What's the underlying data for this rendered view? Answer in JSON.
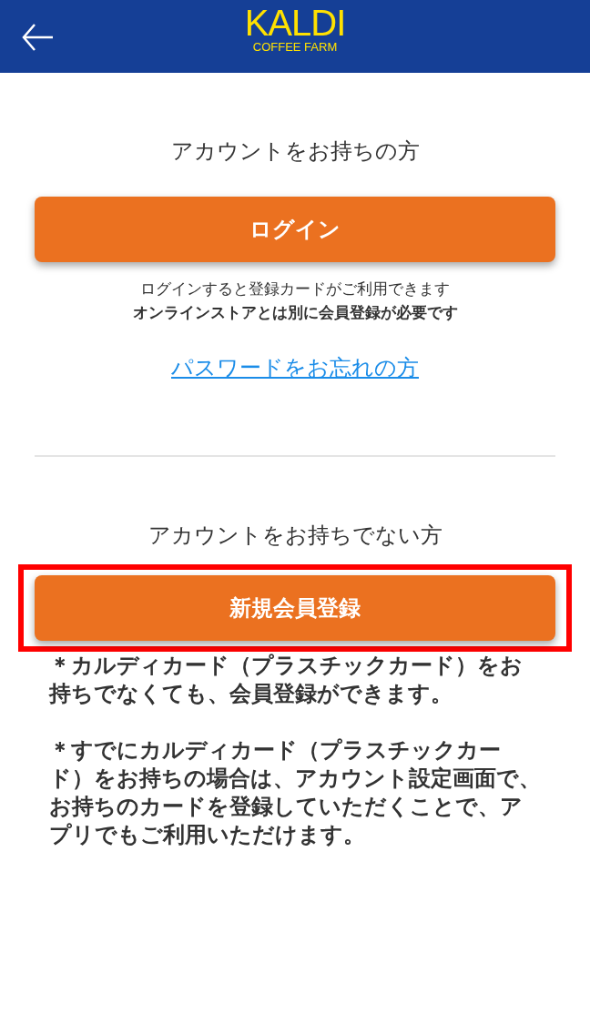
{
  "header": {
    "logo_main": "KALDI",
    "logo_sub": "COFFEE FARM"
  },
  "login_section": {
    "heading": "アカウントをお持ちの方",
    "button": "ログイン",
    "note": "ログインすると登録カードがご利用できます",
    "note_bold": "オンラインストアとは別に会員登録が必要です",
    "link": "パスワードをお忘れの方"
  },
  "register_section": {
    "heading": "アカウントをお持ちでない方",
    "button": "新規会員登録",
    "highlighted": true,
    "notes": [
      "＊カルディカード（プラスチックカード）をお持ちでなくても、会員登録ができます。",
      "＊すでにカルディカード（プラスチックカード）をお持ちの場合は、アカウント設定画面で、お持ちのカードを登録していただくことで、アプリでもご利用いただけます。"
    ]
  }
}
